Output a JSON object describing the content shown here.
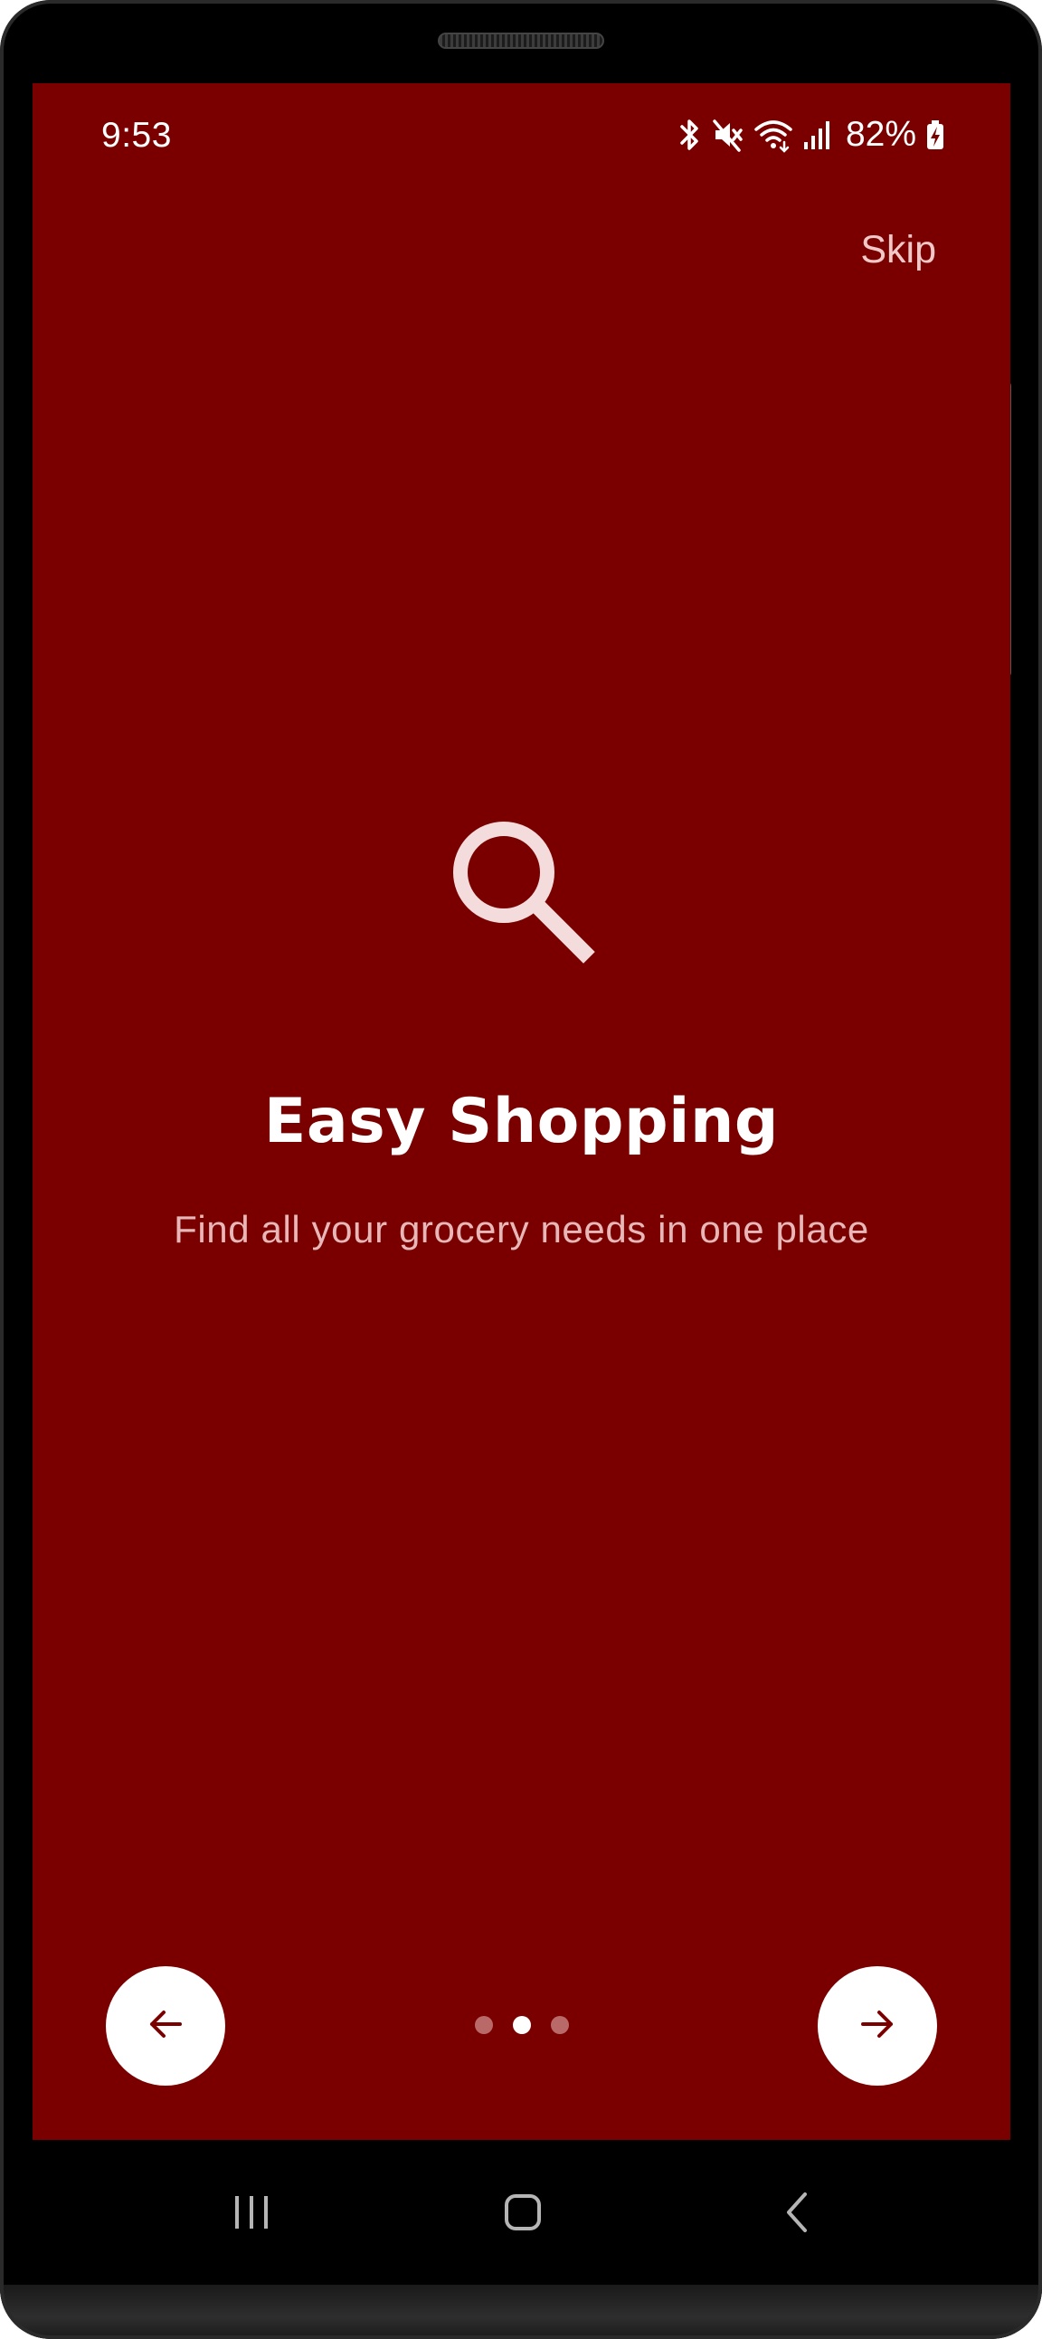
{
  "status_bar": {
    "time": "9:53",
    "battery_percent": "82%",
    "icons": [
      "bluetooth-icon",
      "mute-icon",
      "wifi-icon",
      "signal-icon",
      "battery-charging-icon"
    ]
  },
  "skip": {
    "label": "Skip"
  },
  "onboarding": {
    "icon": "search-icon",
    "title": "Easy Shopping",
    "subtitle": "Find all your grocery needs in one place",
    "page_count": 3,
    "current_page": 2
  },
  "navigation": {
    "prev_icon": "arrow-left-icon",
    "next_icon": "arrow-right-icon"
  },
  "system_nav": {
    "icons": [
      "recents-icon",
      "home-icon",
      "back-icon"
    ]
  },
  "colors": {
    "background": "#7a0000",
    "accent": "#ffffff",
    "subtitle": "#e8b8b8",
    "skip": "#f0c8c8"
  }
}
